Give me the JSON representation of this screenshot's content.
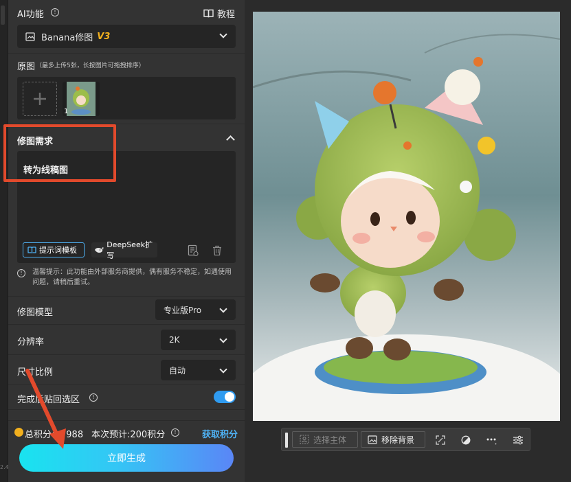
{
  "sidebar": {
    "header": {
      "title": "AI功能",
      "tutorial_label": "教程"
    },
    "tool_selector": {
      "name": "Banana修图",
      "version": "V3"
    },
    "original": {
      "label": "原图",
      "hint": "（最多上传5张，长按图片可拖拽排序）",
      "thumb_index": "1"
    },
    "requirement": {
      "label": "修图需求",
      "text": "转为线稿图",
      "template_button": "提示词模板",
      "deepseek_button": "DeepSeek扩写"
    },
    "notice": "温馨提示：此功能由外部服务商提供，偶有服务不稳定，如遇使用问题，请稍后重试。",
    "model": {
      "label": "修图模型",
      "value": "专业版Pro"
    },
    "resolution": {
      "label": "分辨率",
      "value": "2K"
    },
    "ratio": {
      "label": "尺寸比例",
      "value": "自动"
    },
    "paste_back": {
      "label": "完成后贴回选区",
      "enabled": true
    },
    "points": {
      "total": "总积分：7988",
      "estimate": "本次预计:200积分",
      "get_points": "获取积分"
    },
    "generate_button": "立即生成"
  },
  "version_tag": "2.4",
  "toolbar": {
    "select_subject": "选择主体",
    "remove_background": "移除背景"
  },
  "colors": {
    "accent": "#4fb3f6",
    "annotation_red": "#e24a2c",
    "version_gold": "#f2b01e",
    "toggle_blue": "#2f9bf0"
  }
}
